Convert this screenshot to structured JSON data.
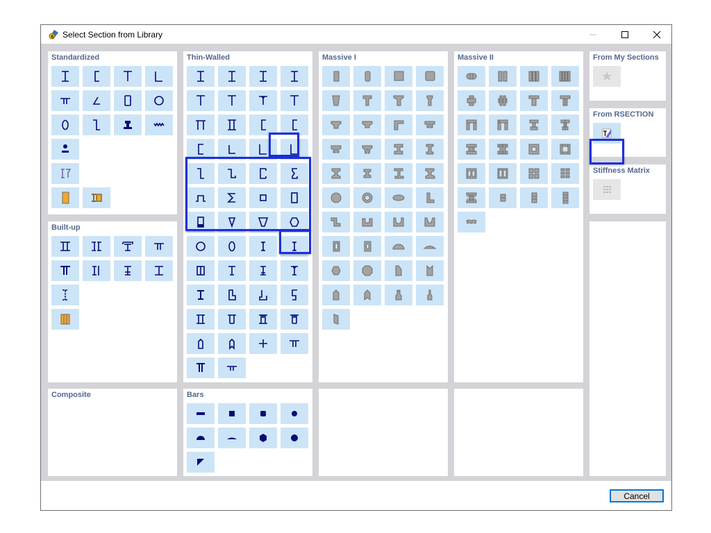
{
  "window": {
    "title": "Select Section from Library",
    "controls": [
      "minimize",
      "maximize",
      "close"
    ]
  },
  "panels": {
    "standardized": {
      "title": "Standardized"
    },
    "thin_walled": {
      "title": "Thin-Walled"
    },
    "massive_1": {
      "title": "Massive I"
    },
    "massive_2": {
      "title": "Massive II"
    },
    "from_my_sections": {
      "title": "From My Sections"
    },
    "from_rsection": {
      "title": "From RSECTION"
    },
    "stiffness_matrix": {
      "title": "Stiffness Matrix"
    },
    "built_up": {
      "title": "Built-up"
    },
    "composite": {
      "title": "Composite"
    },
    "bars": {
      "title": "Bars"
    }
  },
  "footer": {
    "cancel_label": "Cancel"
  },
  "colors": {
    "tile_bg": "#cce4f7",
    "glyph_blue": "#0a0a7a",
    "glyph_gray": "#a0a0a0",
    "orange": "#f5a630",
    "selection": "#1a2fe0",
    "panel_title": "#54688e",
    "background": "#d3d3d8"
  }
}
